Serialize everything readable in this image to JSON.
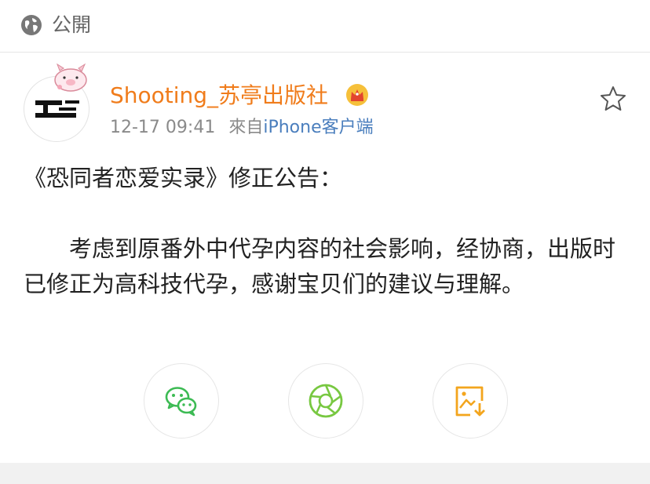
{
  "header": {
    "visibility_icon": "globe-icon",
    "visibility_label": "公開"
  },
  "post": {
    "avatar_icon": "publisher-logo",
    "username": "Shooting_苏亭出版社",
    "badge_icon": "crown-icon",
    "timestamp": "12-17 09:41",
    "source_prefix": "來自",
    "source": "iPhone客户端",
    "favorite_icon": "star-icon",
    "title_line": "《恐同者恋爱实录》修正公告：",
    "body": "考虑到原番外中代孕内容的社会影响，经协商，出版时已修正为高科技代孕，感谢宝贝们的建议与理解。"
  },
  "share_actions": [
    {
      "icon": "wechat-icon",
      "color": "#3dbb54"
    },
    {
      "icon": "moments-icon",
      "color": "#78c841"
    },
    {
      "icon": "save-image-icon",
      "color": "#f3a51d"
    }
  ],
  "colors": {
    "username": "#f07c1b",
    "source_link": "#4a7ebd",
    "meta": "#8a8a8a"
  }
}
